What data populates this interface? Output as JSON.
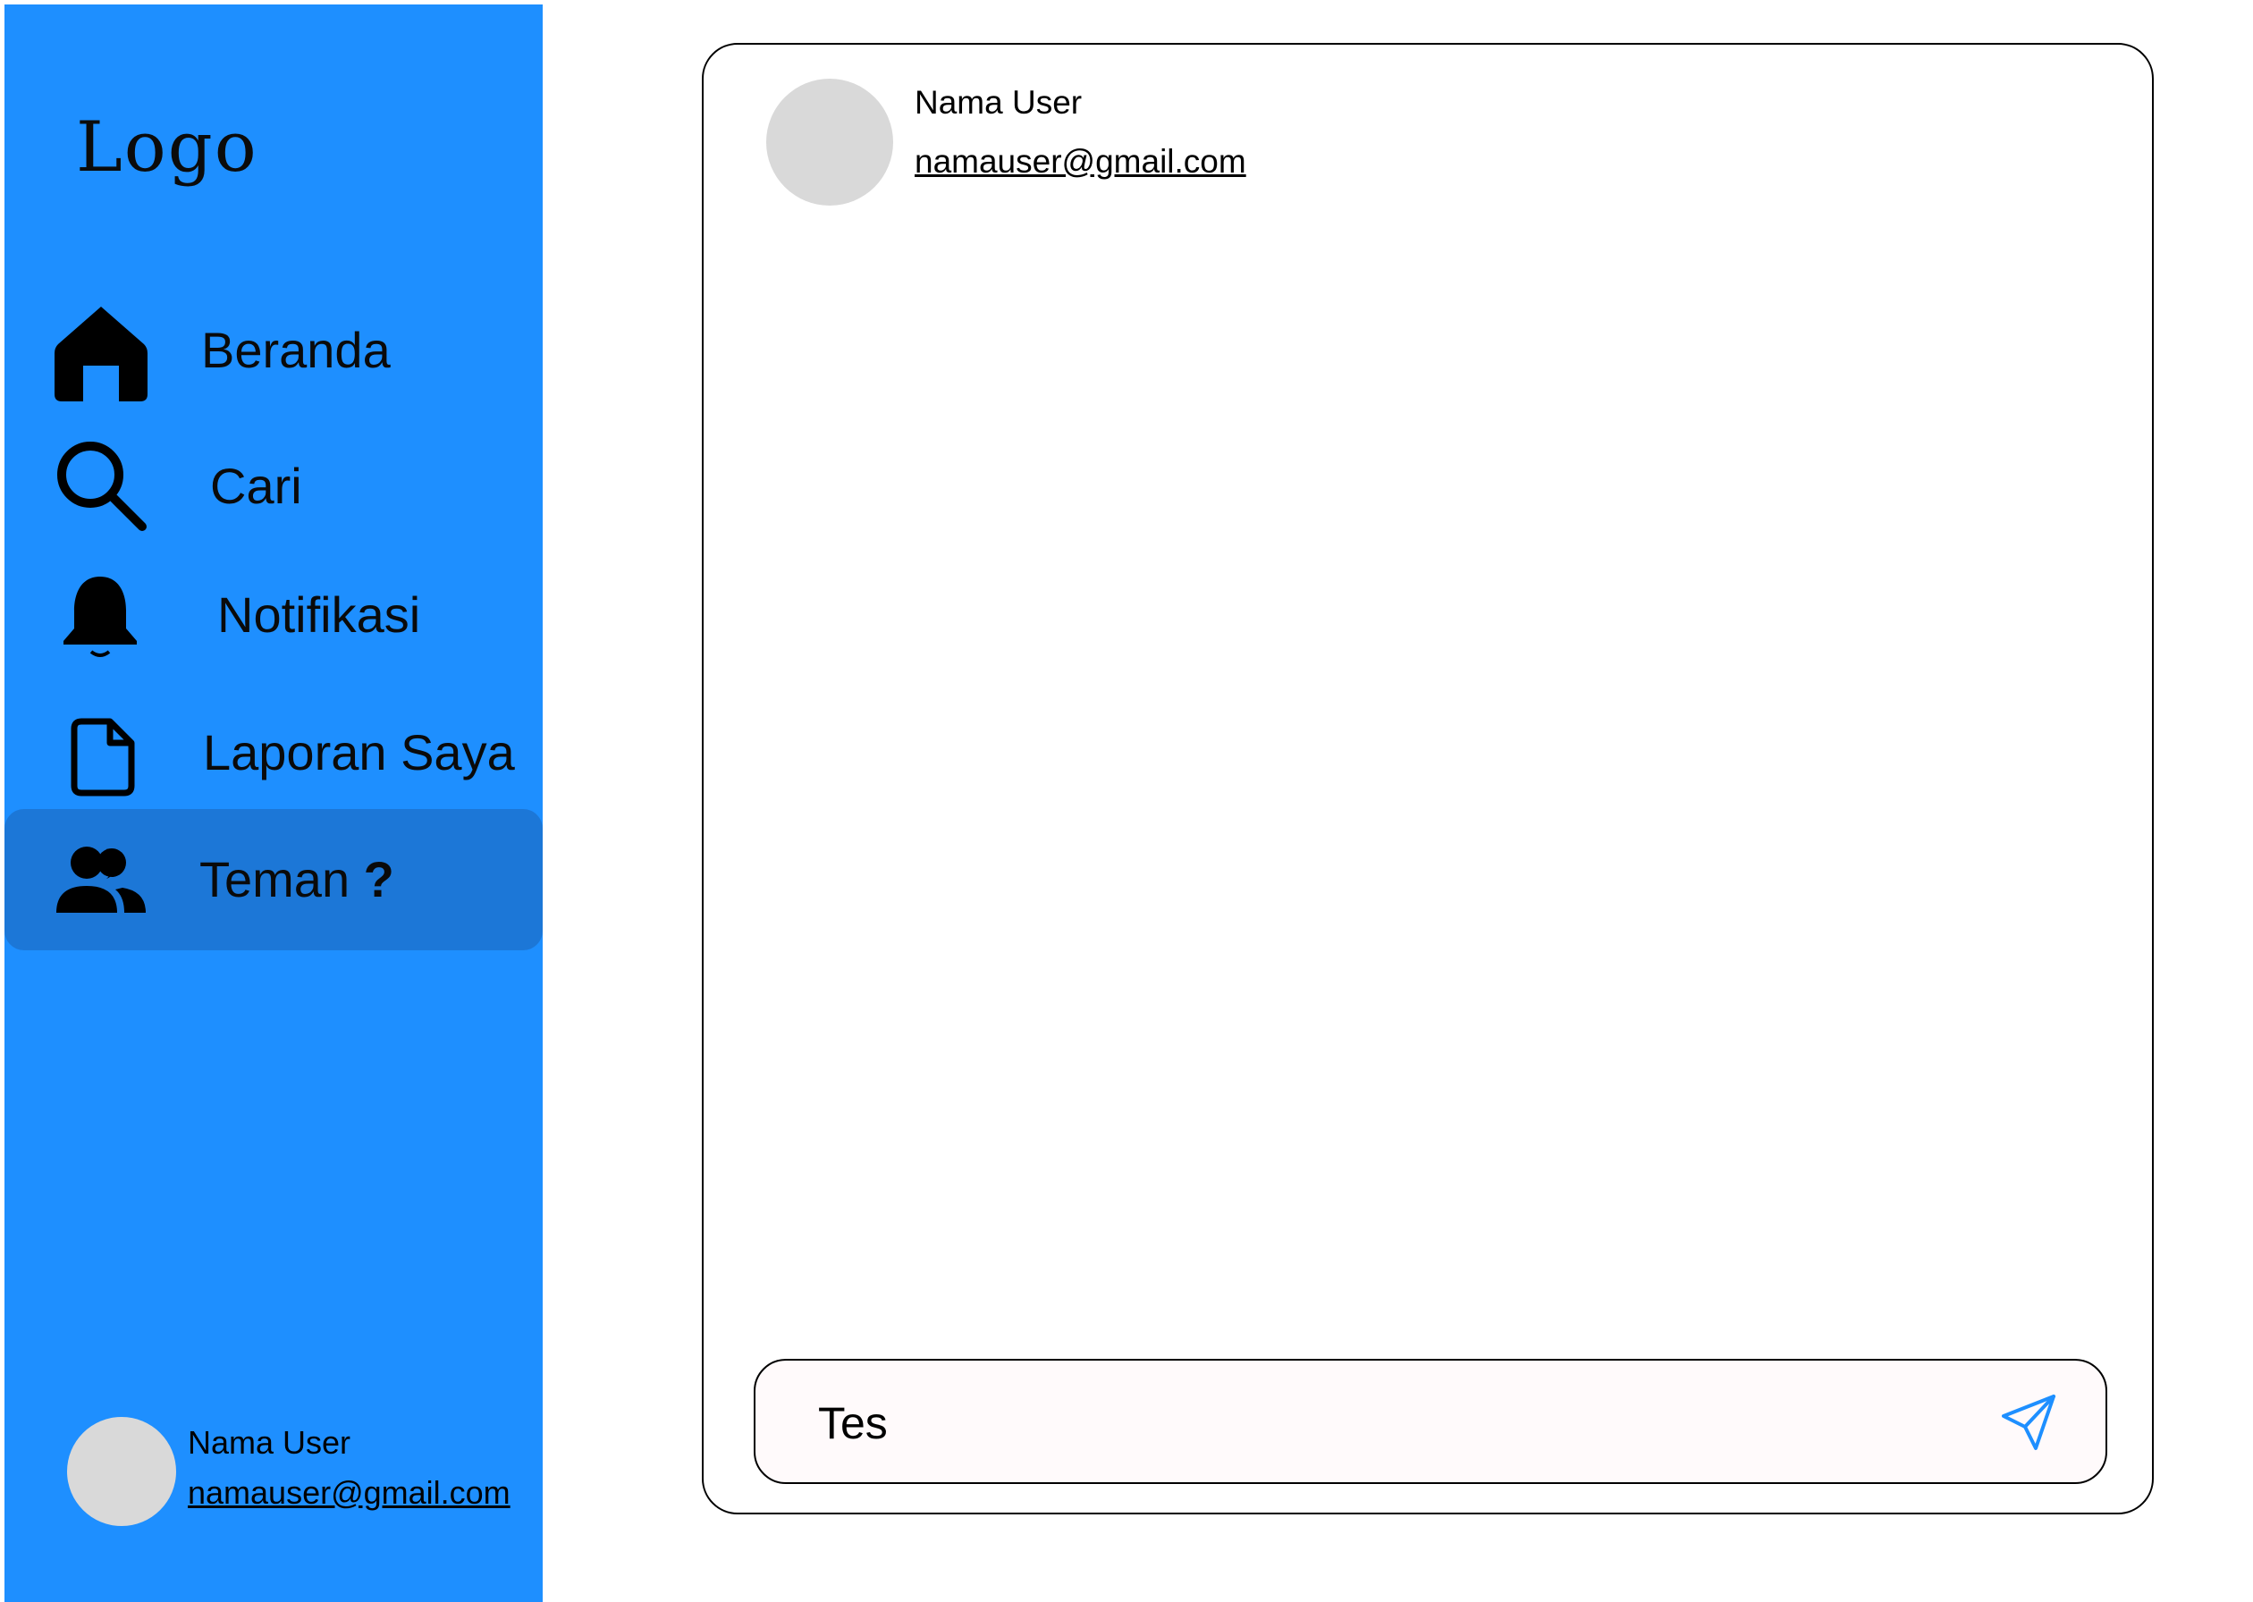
{
  "sidebar": {
    "logo": "Logo",
    "items": [
      {
        "label": "Beranda",
        "icon": "home-icon"
      },
      {
        "label": "Cari",
        "icon": "search-icon"
      },
      {
        "label": "Notifikasi",
        "icon": "bell-icon"
      },
      {
        "label": "Laporan Saya",
        "icon": "document-icon"
      },
      {
        "label": "Teman",
        "suffix": "?",
        "icon": "users-icon",
        "active": true
      }
    ],
    "user": {
      "name": "Nama User",
      "email": "namauser@gmail.com"
    }
  },
  "chat": {
    "header": {
      "name": "Nama User",
      "email": "namauser@gmail.com"
    },
    "composer": {
      "value": "Tes",
      "send_icon": "send-icon"
    }
  },
  "colors": {
    "sidebar_bg": "#1e8fff",
    "active_item_bg": "#1c77d7",
    "avatar": "#d9d9d9",
    "send_icon": "#1e8fff"
  }
}
